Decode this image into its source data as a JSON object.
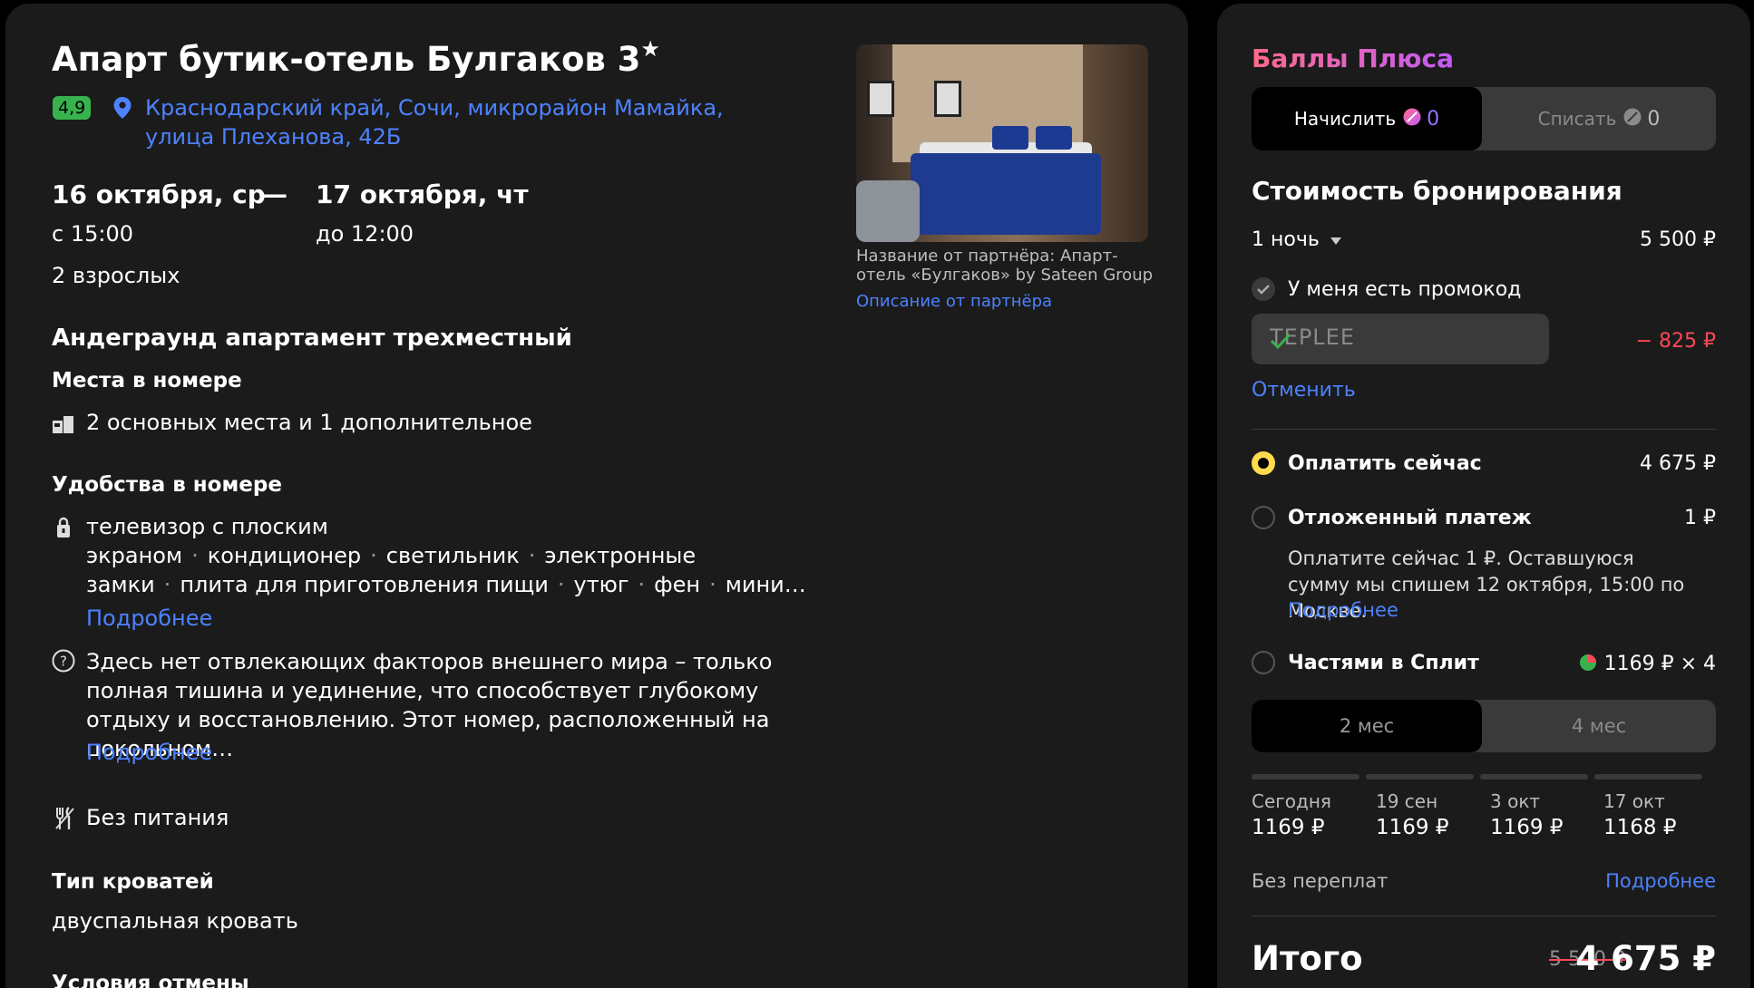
{
  "hotel": {
    "name": "Апарт бутик-отель Булгаков 3",
    "star": "★",
    "rating": "4,9",
    "address": "Краснодарский край, Сочи, микрорайон Мамайка, улица Плеханова, 42Б"
  },
  "stay": {
    "checkin_date": "16 октября, ср",
    "dash": "—",
    "checkout_date": "17 октября, чт",
    "checkin_time": "с 15:00",
    "checkout_time": "до 12:00",
    "guests": "2 взрослых"
  },
  "room": {
    "title": "Андеграунд апартамент трехместный",
    "places_heading": "Места в номере",
    "places": "2 основных места и 1 дополнительное",
    "amenities_heading": "Удобства в номере",
    "amenities_line1": "телевизор с плоским",
    "amenities_line2": [
      "экраном",
      "кондиционер",
      "светильник",
      "электронные"
    ],
    "amenities_line3": [
      "замки",
      "плита для приготовления пищи",
      "утюг",
      "фен",
      "мини…"
    ],
    "more_label": "Подробнее",
    "description": "Здесь нет отвлекающих факторов внешнего мира – только полная тишина и уединение, что способствует глубокому отдыху и восстановлению. Этот номер, расположенный на цокольном…",
    "more_label_2": "Подробнее",
    "meals": "Без питания",
    "bed_heading": "Тип кроватей",
    "bed": "двуспальная кровать",
    "cancel_heading": "Условия отмены"
  },
  "partner": {
    "caption": "Название от партнёра: Апарт-отель «Булгаков» by Sateen Group",
    "description_link": "Описание от партнёра"
  },
  "plus": {
    "title": "Баллы Плюса",
    "earn_label": "Начислить",
    "earn_value": "0",
    "spend_label": "Списать",
    "spend_value": "0"
  },
  "booking": {
    "title": "Стоимость бронирования",
    "nights": "1 ночь",
    "nights_price": "5 500 ₽",
    "promo_checkbox": "У меня есть промокод",
    "promo_code": "TEPLEE",
    "promo_discount": "− 825 ₽",
    "cancel_link": "Отменить"
  },
  "payment": {
    "now_label": "Оплатить сейчас",
    "now_price": "4 675 ₽",
    "deferred_label": "Отложенный платеж",
    "deferred_price": "1 ₽",
    "deferred_note": "Оплатите сейчас 1 ₽. Оставшуюся сумму мы спишем 12 октября, 15:00 по Москве.",
    "deferred_more": "Подробнее",
    "split_label": "Частями в Сплит",
    "split_price": "1169 ₽ × 4",
    "split_tab_2": "2 мес",
    "split_tab_4": "4 мес",
    "schedule": [
      {
        "date": "Сегодня",
        "amount": "1169 ₽"
      },
      {
        "date": "19 сен",
        "amount": "1169 ₽"
      },
      {
        "date": "3 окт",
        "amount": "1169 ₽"
      },
      {
        "date": "17 окт",
        "amount": "1168 ₽"
      }
    ],
    "no_overpay": "Без переплат",
    "split_more": "Подробнее"
  },
  "total": {
    "label": "Итого",
    "old_price": "5 500 ₽",
    "price": "4 675 ₽"
  },
  "colors": {
    "link": "#4d82ff",
    "rating": "#37b24d",
    "discount": "#ff4757",
    "radio_active": "#ffdb4d",
    "plus_gradient_start": "#ff6b8a",
    "plus_gradient_end": "#c25cf7"
  }
}
